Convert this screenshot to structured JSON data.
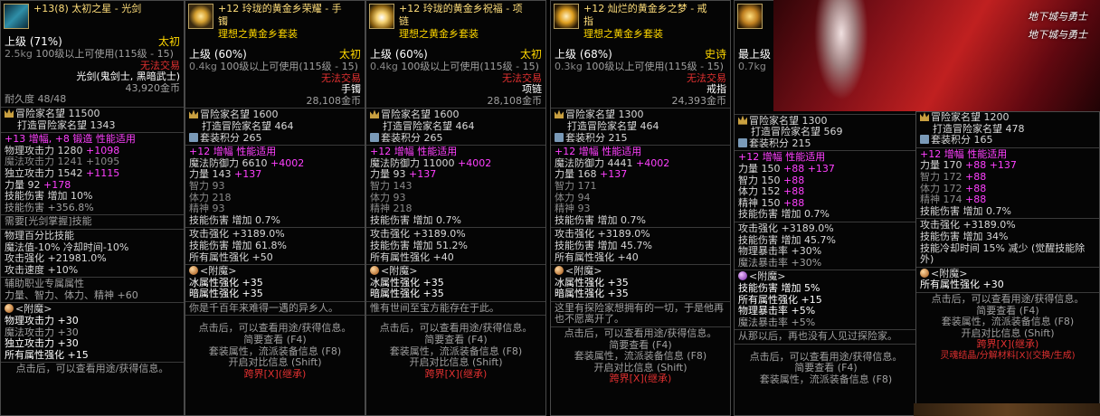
{
  "panels": [
    {
      "icon": "sword-icon",
      "title": [
        "+13(8) 太初之星 - 光剑"
      ],
      "set_name": "",
      "grade": "上级 (71%)",
      "rarity": "太初",
      "weight": "2.5kg",
      "level_req": "100级以上可使用(115级 - 15)",
      "trade": "无法交易",
      "type": "光剑(鬼剑士, 黑暗武士)",
      "price": "43,920金币",
      "durability": "耐久度 48/48",
      "fame": "冒险家名望 11500",
      "forge_fame": "打造冒险家名望 1343",
      "set_points": "",
      "amp_line": "+13 增幅, +8 锻造 性能适用",
      "stats": [
        {
          "label": "物理攻击力 1280",
          "bonus": "+1098"
        },
        {
          "label": "魔法攻击力 1241",
          "bonus": "+1095"
        },
        {
          "label": "独立攻击力 1542",
          "bonus": "+1115"
        },
        {
          "label": "力量 92",
          "bonus": "+178"
        }
      ],
      "skill_dmg": "技能伤害 增加 10%",
      "skill_dmg2": "技能伤害 +356.8%",
      "extra": [
        "需要[光剑掌握]技能",
        "物理百分比技能",
        "魔法值-10% 冷却时间-10%",
        "攻击强化 +21981.0%",
        "攻击速度 +10%",
        "辅助职业专属属性",
        "力量、智力、体力、精神 +60"
      ],
      "enchant_title": "<附魔>",
      "enchant": [
        "物理攻击力 +30",
        "魔法攻击力 +30",
        "独立攻击力 +30",
        "所有属性强化 +15"
      ],
      "flavor": "",
      "footer": [
        "点击后，可以查看用途/获得信息。"
      ]
    },
    {
      "icon": "bracelet-icon",
      "title": [
        "+12 玲珑的黄金乡荣耀 - 手",
        "镯"
      ],
      "set_name": "理想之黄金乡套装",
      "grade": "上级 (60%)",
      "rarity": "太初",
      "weight": "0.4kg",
      "level_req": "100级以上可使用(115级 - 15)",
      "trade": "无法交易",
      "type": "手镯",
      "price": "28,108金币",
      "fame": "冒险家名望 1600",
      "forge_fame": "打造冒险家名望 464",
      "set_points": "套装积分 265",
      "amp_line": "+12 增幅 性能适用",
      "stats": [
        {
          "label": "魔法防御力 6610",
          "bonus": "+4002"
        },
        {
          "label": "力量 143",
          "bonus": "+137"
        },
        {
          "label": "智力 93",
          "bonus": ""
        },
        {
          "label": "体力 218",
          "bonus": ""
        },
        {
          "label": "精神 93",
          "bonus": ""
        }
      ],
      "skill_dmg": "技能伤害 增加 0.7%",
      "extra": [
        "攻击强化 +3189.0%",
        "技能伤害 增加 61.8%",
        "所有属性强化 +50"
      ],
      "enchant_title": "<附魔>",
      "enchant": [
        "冰属性强化 +35",
        "暗属性强化 +35"
      ],
      "flavor": "你是千百年来难得一遇的异乡人。",
      "footer": [
        "点击后，可以查看用途/获得信息。",
        "简要查看 (F4)",
        "套装属性，流派装备信息 (F8)",
        "开启对比信息 (Shift)",
        "跨界[X](继承)"
      ]
    },
    {
      "icon": "necklace-icon",
      "title": [
        "+12 玲珑的黄金乡祝福 - 项",
        "链"
      ],
      "set_name": "理想之黄金乡套装",
      "grade": "上级 (60%)",
      "rarity": "太初",
      "weight": "0.4kg",
      "level_req": "100级以上可使用(115级 - 15)",
      "trade": "无法交易",
      "type": "项链",
      "price": "28,108金币",
      "fame": "冒险家名望 1600",
      "forge_fame": "打造冒险家名望 464",
      "set_points": "套装积分 265",
      "amp_line": "+12 增幅 性能适用",
      "stats": [
        {
          "label": "魔法防御力 11000",
          "bonus": "+4002"
        },
        {
          "label": "力量 93",
          "bonus": "+137"
        },
        {
          "label": "智力 143",
          "bonus": ""
        },
        {
          "label": "体力 93",
          "bonus": ""
        },
        {
          "label": "精神 218",
          "bonus": ""
        }
      ],
      "skill_dmg": "技能伤害 增加 0.7%",
      "extra": [
        "攻击强化 +3189.0%",
        "技能伤害 增加 51.2%",
        "所有属性强化 +40"
      ],
      "enchant_title": "<附魔>",
      "enchant": [
        "冰属性强化 +35",
        "暗属性强化 +35"
      ],
      "flavor": "惟有世间至宝方能存在于此。",
      "footer": [
        "点击后，可以查看用途/获得信息。",
        "简要查看 (F4)",
        "套装属性，流派装备信息 (F8)",
        "开启对比信息 (Shift)",
        "跨界[X](继承)"
      ]
    },
    {
      "icon": "ring-icon",
      "title": [
        "+12 灿烂的黄金乡之梦 - 戒",
        "指"
      ],
      "set_name": "理想之黄金乡套装",
      "grade": "上级 (68%)",
      "rarity": "史诗",
      "weight": "0.3kg",
      "level_req": "100级以上可使用(115级 - 15)",
      "trade": "无法交易",
      "type": "戒指",
      "price": "24,393金币",
      "fame": "冒险家名望 1300",
      "forge_fame": "打造冒险家名望 464",
      "set_points": "套装积分 215",
      "amp_line": "+12 增幅 性能适用",
      "stats": [
        {
          "label": "魔法防御力 4441",
          "bonus": "+4002"
        },
        {
          "label": "力量 168",
          "bonus": "+137"
        },
        {
          "label": "智力 171",
          "bonus": ""
        },
        {
          "label": "体力 94",
          "bonus": ""
        },
        {
          "label": "精神 93",
          "bonus": ""
        }
      ],
      "skill_dmg": "技能伤害 增加 0.7%",
      "extra": [
        "攻击强化 +3189.0%",
        "技能伤害 增加 45.7%",
        "所有属性强化 +40"
      ],
      "enchant_title": "<附魔>",
      "enchant": [
        "冰属性强化 +35",
        "暗属性强化 +35"
      ],
      "flavor": "这里有探险家想拥有的一切，于是他再也不愿离开了。",
      "footer": [
        "点击后，可以查看用途/获得信息。",
        "简要查看 (F4)",
        "套装属性，流派装备信息 (F8)",
        "开启对比信息 (Shift)",
        "跨界[X](继承)"
      ]
    },
    {
      "icon": "item-icon",
      "title": [
        ""
      ],
      "set_name": "",
      "grade": "最上级",
      "rarity": "",
      "weight": "0.7kg",
      "level_req": "",
      "trade": "",
      "type": "",
      "price": "",
      "fame": "冒险家名望 1300",
      "forge_fame": "打造冒险家名望 569",
      "set_points": "套装积分 215",
      "amp_line": "+12 增幅 性能适用",
      "stats": [
        {
          "label": "力量 150",
          "bonus": "+88 +137"
        },
        {
          "label": "智力 150",
          "bonus": "+88"
        },
        {
          "label": "体力 152",
          "bonus": "+88"
        },
        {
          "label": "精神 150",
          "bonus": "+88"
        }
      ],
      "skill_dmg": "技能伤害 增加 0.7%",
      "extra": [
        "攻击强化 +3189.0%",
        "技能伤害 增加 45.7%",
        "物理暴击率 +30%",
        "魔法暴击率 +30%"
      ],
      "enchant_title": "<附魔>",
      "enchant": [
        "技能伤害 增加 5%",
        "所有属性强化 +15",
        "物理暴击率 +5%",
        "魔法暴击率 +5%"
      ],
      "flavor": "从那以后，再也没有人见过探险家。",
      "footer": [
        "点击后，可以查看用途/获得信息。",
        "简要查看 (F4)",
        "套装属性，流派装备信息 (F8)"
      ]
    },
    {
      "icon": "item-icon",
      "title": [
        ""
      ],
      "set_name": "",
      "grade": "",
      "rarity": "",
      "weight": "",
      "level_req": "",
      "trade": "",
      "type": "",
      "price": "",
      "fame": "冒险家名望 1200",
      "forge_fame": "打造冒险家名望 478",
      "set_points": "套装积分 165",
      "amp_line": "+12 增幅 性能适用",
      "stats": [
        {
          "label": "力量 170",
          "bonus": "+88 +137"
        },
        {
          "label": "智力 172",
          "bonus": "+88"
        },
        {
          "label": "体力 172",
          "bonus": "+88"
        },
        {
          "label": "精神 174",
          "bonus": "+88"
        }
      ],
      "skill_dmg": "技能伤害 增加 0.7%",
      "extra": [
        "攻击强化 +3189.0%",
        "技能伤害 增加 34%",
        "技能冷却时间 15% 减少 (觉醒技能除",
        "外)"
      ],
      "enchant_title": "<附魔>",
      "enchant": [
        "所有属性强化 +30"
      ],
      "flavor": "",
      "footer": [
        "点击后，可以查看用途/获得信息。",
        "简要查看 (F4)",
        "套装属性，流派装备信息 (F8)",
        "开启对比信息 (Shift)",
        "跨界[X](继承)",
        "灵魂结晶/分解材料[X](交换/生成)"
      ]
    }
  ],
  "banner": {
    "logo": "地下城与勇士"
  }
}
